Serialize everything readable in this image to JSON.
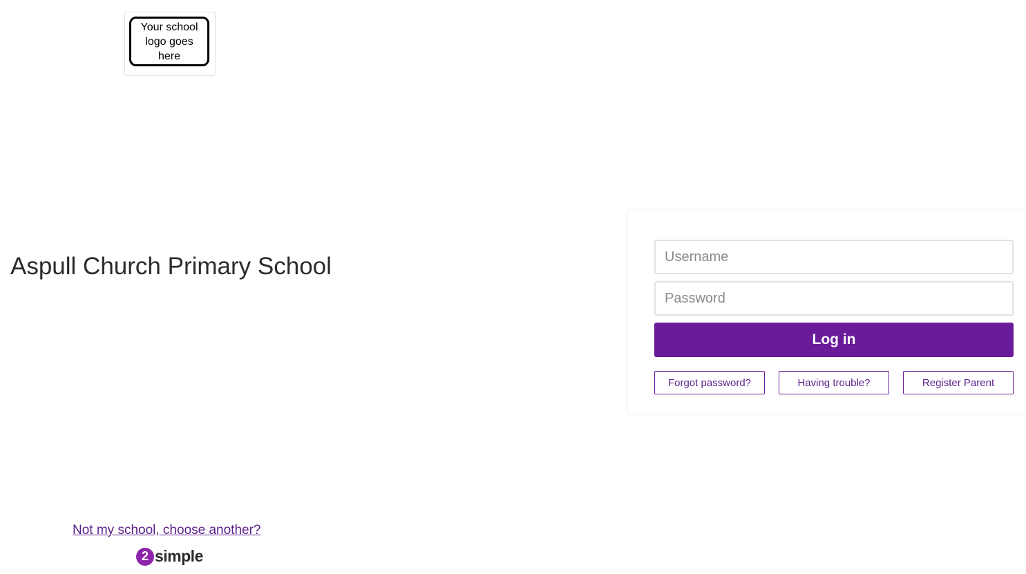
{
  "logo": {
    "text": "Your school logo goes here"
  },
  "school": {
    "name": "Aspull Church Primary School"
  },
  "login": {
    "username_placeholder": "Username",
    "password_placeholder": "Password",
    "username_value": "",
    "password_value": "",
    "submit_label": "Log in",
    "forgot_label": "Forgot password?",
    "trouble_label": "Having trouble?",
    "register_label": "Register Parent"
  },
  "footer": {
    "change_school_label": "Not my school, choose another?",
    "brand_number": "2",
    "brand_word": "simple"
  },
  "colors": {
    "accent": "#6a1b9a",
    "brand_badge": "#8e24aa",
    "link": "#5b1f8a"
  }
}
